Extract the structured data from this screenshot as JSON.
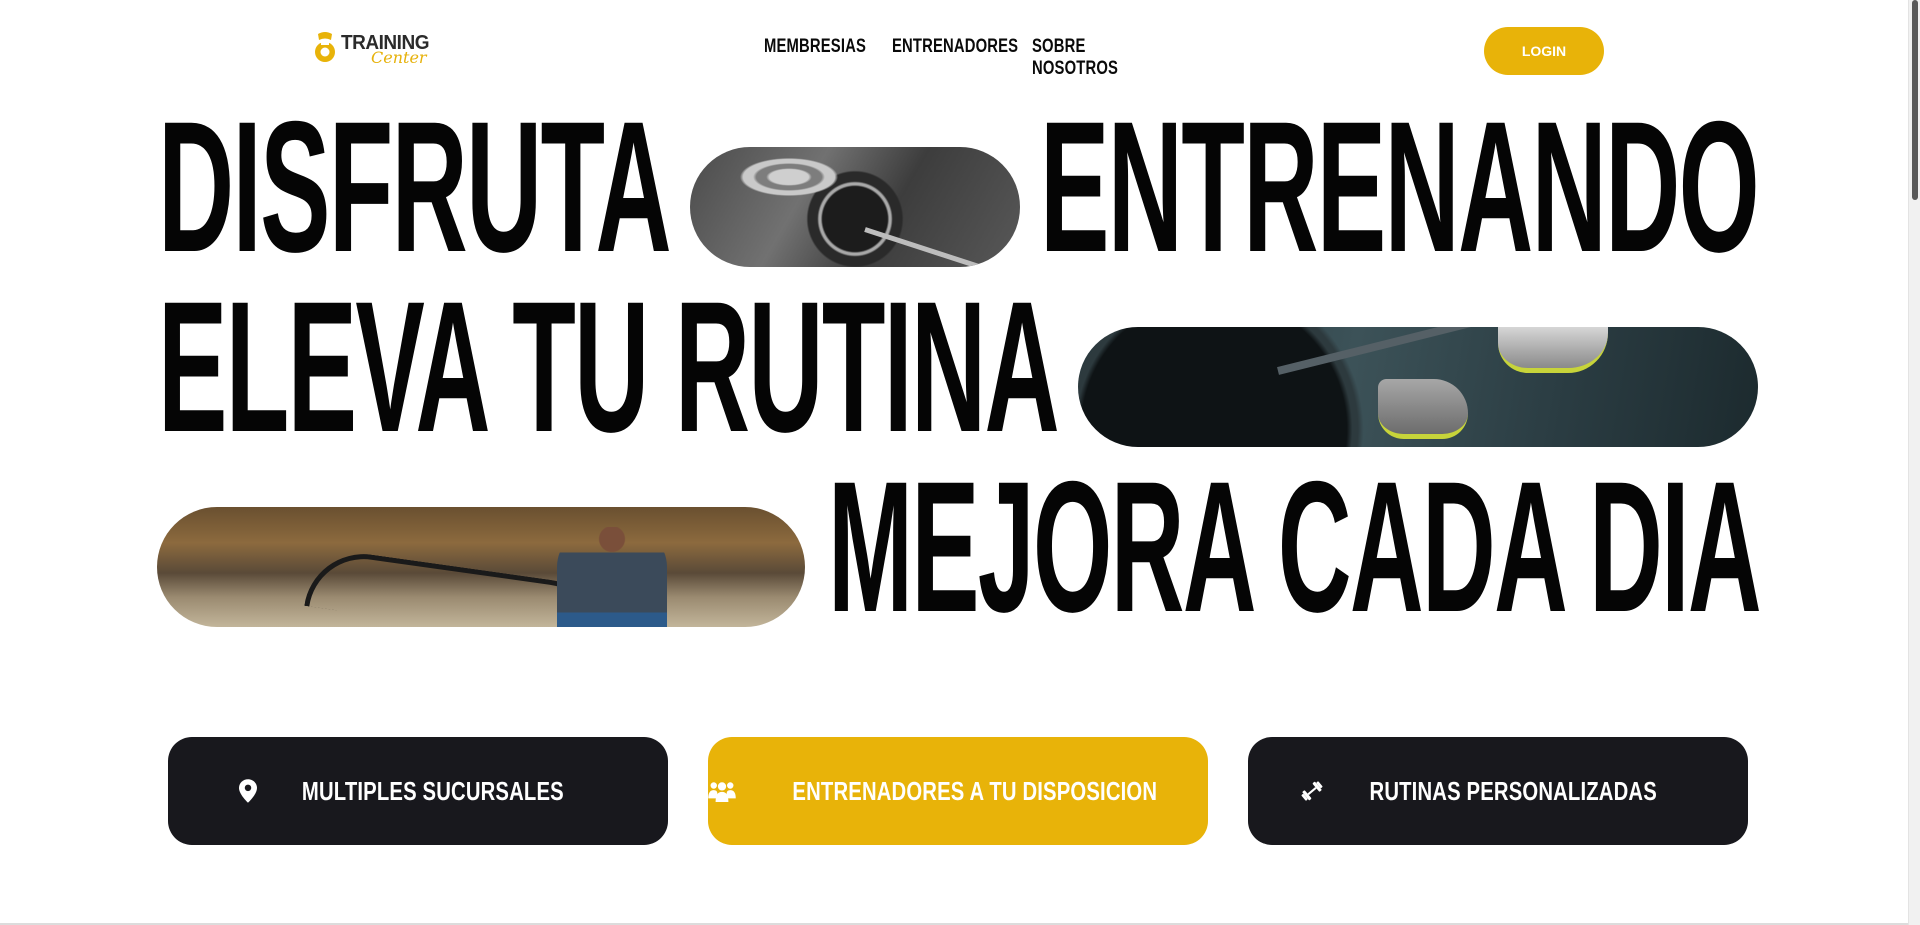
{
  "header": {
    "logo_line1": "TRAINING",
    "logo_line2": "Center",
    "nav": [
      "MEMBRESIAS",
      "ENTRENADORES",
      "SOBRE NOSOTROS"
    ],
    "login_label": "LOGIN"
  },
  "hero": {
    "row1_left": "DISFRUTA",
    "row1_right": "ENTRENANDO",
    "row2_left": "ELEVA TU RUTINA",
    "row3_right": "MEJORA CADA DIA"
  },
  "features": [
    {
      "label": "MULTIPLES SUCURSALES",
      "icon": "location-pin-icon"
    },
    {
      "label": "ENTRENADORES A TU DISPOSICION",
      "icon": "people-group-icon"
    },
    {
      "label": "RUTINAS PERSONALIZADAS",
      "icon": "dumbbell-icon"
    }
  ],
  "colors": {
    "accent": "#e8b309",
    "dark": "#18181d",
    "text": "#050505"
  }
}
